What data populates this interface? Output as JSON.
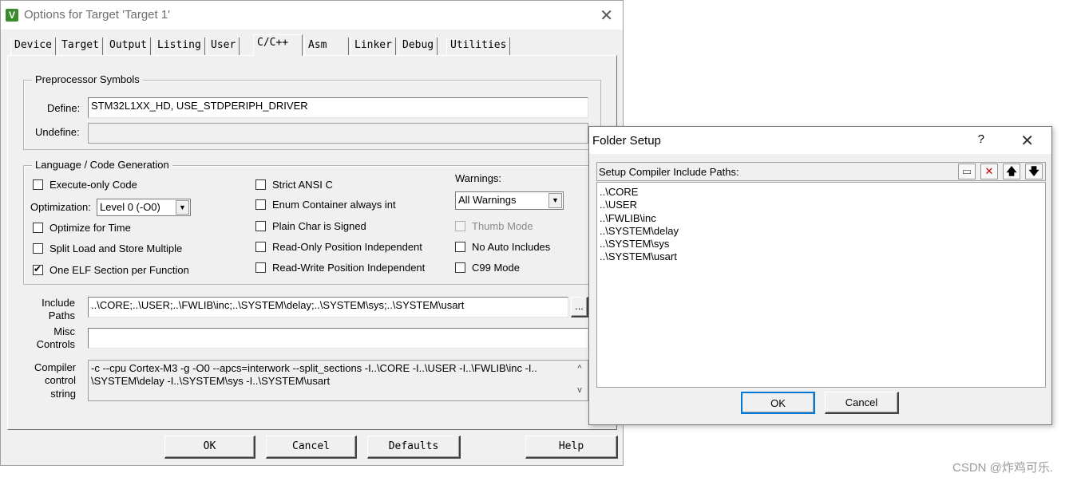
{
  "main_dialog": {
    "title": "Options for Target 'Target 1'",
    "icon_glyph": "V",
    "close_glyph": "✕",
    "tabs": [
      {
        "label": "Device"
      },
      {
        "label": "Target"
      },
      {
        "label": "Output"
      },
      {
        "label": "Listing"
      },
      {
        "label": "User"
      },
      {
        "label": "C/C++"
      },
      {
        "label": "Asm"
      },
      {
        "label": "Linker"
      },
      {
        "label": "Debug"
      },
      {
        "label": "Utilities"
      }
    ],
    "active_tab": "C/C++",
    "preprocessor": {
      "group_title": "Preprocessor Symbols",
      "define_label": "Define:",
      "define_value": "STM32L1XX_HD, USE_STDPERIPH_DRIVER",
      "undefine_label": "Undefine:",
      "undefine_value": ""
    },
    "language": {
      "group_title": "Language / Code Generation",
      "execute_only": {
        "label": "Execute-only Code",
        "checked": false
      },
      "optimization_label": "Optimization:",
      "optimization_value": "Level 0 (-O0)",
      "optimize_time": {
        "label": "Optimize for Time",
        "checked": false
      },
      "split_load": {
        "label": "Split Load and Store Multiple",
        "checked": false
      },
      "one_elf": {
        "label": "One ELF Section per Function",
        "checked": true
      },
      "strict_ansi": {
        "label": "Strict ANSI C",
        "checked": false
      },
      "enum_container": {
        "label": "Enum Container always int",
        "checked": false
      },
      "plain_char": {
        "label": "Plain Char is Signed",
        "checked": false
      },
      "ro_pos": {
        "label": "Read-Only Position Independent",
        "checked": false
      },
      "rw_pos": {
        "label": "Read-Write Position Independent",
        "checked": false
      },
      "warnings_label": "Warnings:",
      "warnings_value": "All Warnings",
      "thumb_mode": {
        "label": "Thumb Mode",
        "checked": false,
        "disabled": true
      },
      "no_auto_includes": {
        "label": "No Auto Includes",
        "checked": false
      },
      "c99_mode": {
        "label": "C99 Mode",
        "checked": false
      }
    },
    "include_paths": {
      "label_line1": "Include",
      "label_line2": "Paths",
      "value": "..\\CORE;..\\USER;..\\FWLIB\\inc;..\\SYSTEM\\delay;..\\SYSTEM\\sys;..\\SYSTEM\\usart",
      "browse_label": "..."
    },
    "misc_controls": {
      "label_line1": "Misc",
      "label_line2": "Controls",
      "value": ""
    },
    "compiler_string": {
      "label_line1": "Compiler",
      "label_line2": "control",
      "label_line3": "string",
      "line1": "-c --cpu Cortex-M3 -g -O0 --apcs=interwork --split_sections -I..\\CORE -I..\\USER -I..\\FWLIB\\inc -I..",
      "line2": "\\SYSTEM\\delay -I..\\SYSTEM\\sys -I..\\SYSTEM\\usart",
      "scroll_up": "^",
      "scroll_down": "v"
    },
    "buttons": {
      "ok": "OK",
      "cancel": "Cancel",
      "defaults": "Defaults",
      "help": "Help"
    }
  },
  "folder_dialog": {
    "title": "Folder Setup",
    "help_glyph": "?",
    "close_glyph": "✕",
    "list_label": "Setup Compiler Include Paths:",
    "toolbar": {
      "new_icon": "new-folder-icon",
      "delete_icon": "delete-icon",
      "up_icon": "move-up-icon",
      "down_icon": "move-down-icon",
      "new_glyph": "▭",
      "delete_glyph": "✕",
      "up_glyph": "🡅",
      "down_glyph": "🡇"
    },
    "paths": [
      "..\\CORE",
      "..\\USER",
      "..\\FWLIB\\inc",
      "..\\SYSTEM\\delay",
      "..\\SYSTEM\\sys",
      "..\\SYSTEM\\usart"
    ],
    "ok_label": "OK",
    "cancel_label": "Cancel"
  },
  "watermark": "CSDN @炸鸡可乐."
}
